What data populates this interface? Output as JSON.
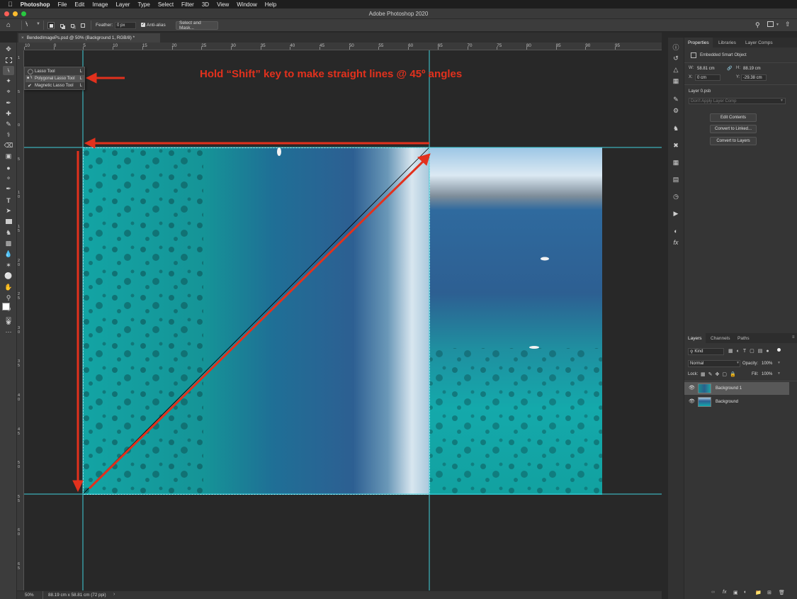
{
  "menubar": {
    "apple_icon": "apple-icon",
    "app": "Photoshop",
    "items": [
      "File",
      "Edit",
      "Image",
      "Layer",
      "Type",
      "Select",
      "Filter",
      "3D",
      "View",
      "Window",
      "Help"
    ]
  },
  "window": {
    "title": "Adobe Photoshop 2020"
  },
  "options": {
    "feather_label": "Feather:",
    "feather_value": "0 px",
    "antialias_label": "Anti-alias",
    "antialias_checked": true,
    "select_mask": "Select and Mask..."
  },
  "document": {
    "tab_title": "BendedImagePs.psd @ 50% (Background 1, RGB/8) *"
  },
  "ruler": {
    "top_ticks": [
      "10",
      "0",
      "5",
      "10",
      "15",
      "20",
      "25",
      "30",
      "35",
      "40",
      "45",
      "50",
      "55",
      "60",
      "65",
      "70",
      "75",
      "80",
      "85",
      "90",
      "95"
    ],
    "left_ticks": [
      "1",
      "5",
      "0",
      "5",
      "1\n0",
      "1\n5",
      "2\n0",
      "2\n5",
      "3\n0",
      "3\n5",
      "4\n0",
      "4\n5",
      "5\n0",
      "5\n5",
      "6\n0",
      "6\n5"
    ]
  },
  "flyout": {
    "items": [
      {
        "label": "Lasso Tool",
        "key": "L",
        "icon": "lasso-icon"
      },
      {
        "label": "Polygonal Lasso Tool",
        "key": "L",
        "icon": "polygonal-lasso-icon"
      },
      {
        "label": "Magnetic Lasso Tool",
        "key": "L",
        "icon": "magnetic-lasso-icon"
      }
    ],
    "selected_index": 1
  },
  "annotation": {
    "text": "Hold “Shift” key to make straight lines @ 45º angles",
    "color": "#e2311d"
  },
  "status": {
    "zoom": "50%",
    "doc_info": "88.19 cm x 58.81 cm (72 ppi)"
  },
  "properties": {
    "tabs": [
      "Properties",
      "Libraries",
      "Layer Comps"
    ],
    "object_type": "Embedded Smart Object",
    "w_label": "W:",
    "w_value": "58.81 cm",
    "h_label": "H:",
    "h_value": "88.19 cm",
    "x_label": "X:",
    "x_value": "0 cm",
    "y_label": "Y:",
    "y_value": "-29.38 cm",
    "layer_file": "Layer 0.psb",
    "comp_placeholder": "Don't Apply Layer Comp",
    "buttons": [
      "Edit Contents",
      "Convert to Linked...",
      "Convert to Layers"
    ]
  },
  "layers": {
    "tabs": [
      "Layers",
      "Channels",
      "Paths"
    ],
    "filter_kind": "Kind",
    "blend_mode": "Normal",
    "opacity_label": "Opacity:",
    "opacity_value": "100%",
    "lock_label": "Lock:",
    "fill_label": "Fill:",
    "fill_value": "100%",
    "items": [
      {
        "name": "Background 1",
        "visible": true,
        "selected": true
      },
      {
        "name": "Background",
        "visible": true,
        "selected": false
      }
    ]
  },
  "colors": {
    "accent": "#e2311d",
    "guide": "#3fd0dc",
    "panel": "#353535"
  }
}
